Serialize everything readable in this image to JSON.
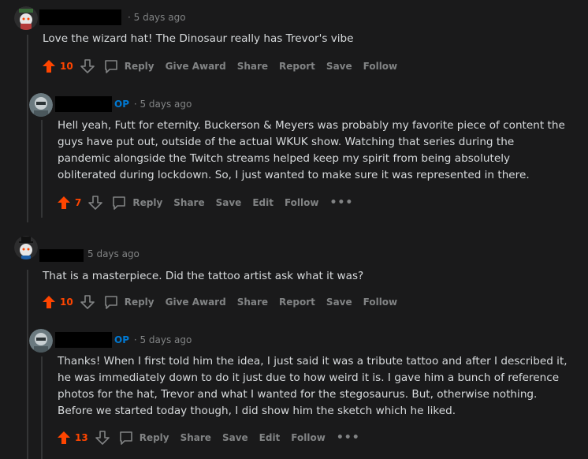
{
  "comments": [
    {
      "timestamp": "5 days ago",
      "op_badge": "",
      "body": [
        "Love the wizard hat! The Dinosaur really has Trevor's vibe"
      ],
      "votes": "10",
      "actions": [
        "Reply",
        "Give Award",
        "Share",
        "Report",
        "Save",
        "Follow"
      ]
    },
    {
      "timestamp": "5 days ago",
      "op_badge": "OP",
      "body": [
        "Hell yeah, Futt for eternity. Buckerson & Meyers was probably my favorite piece of content the",
        "guys have put out, outside of the actual WKUK show. Watching that series during the",
        "pandemic alongside the Twitch streams helped keep my spirit from being absolutely",
        "obliterated during lockdown. So, I just wanted to make sure it was represented in there."
      ],
      "votes": "7",
      "actions": [
        "Reply",
        "Share",
        "Save",
        "Edit",
        "Follow"
      ],
      "more": "•••"
    },
    {
      "timestamp": "5 days ago",
      "op_badge": "",
      "body": [
        "That is a masterpiece. Did the tattoo artist ask what it was?"
      ],
      "votes": "10",
      "actions": [
        "Reply",
        "Give Award",
        "Share",
        "Report",
        "Save",
        "Follow"
      ]
    },
    {
      "timestamp": "5 days ago",
      "op_badge": "OP",
      "body": [
        "Thanks! When I first told him the idea, I just said it was a tribute tattoo and after I described it,",
        "he was immediately down to do it just due to how weird it is. I gave him a bunch of reference",
        "photos for the hat, Trevor and what I wanted for the stegosaurus. But, otherwise nothing.",
        "Before we started today though, I did show him the sketch which he liked."
      ],
      "votes": "13",
      "actions": [
        "Reply",
        "Share",
        "Save",
        "Edit",
        "Follow"
      ],
      "more": "•••"
    }
  ],
  "icons": {
    "upvote": "upvote-arrow-icon",
    "downvote": "downvote-arrow-icon",
    "reply": "speech-bubble-icon",
    "more": "more-dots-icon"
  },
  "colors": {
    "background": "#1a1a1b",
    "text": "#d7dadc",
    "muted": "#818384",
    "upvote": "#ff4500",
    "op_badge": "#0079d3"
  }
}
